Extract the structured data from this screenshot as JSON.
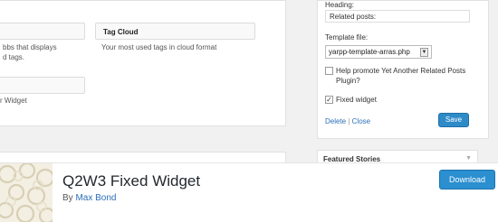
{
  "admin": {
    "widgets": {
      "tag_cloud_title": "Tag Cloud",
      "tag_cloud_desc": "Your most used tags in cloud format",
      "left_desc_line1": "bbs that displays",
      "left_desc_line2": "d tags.",
      "left_widget_desc": "r Widget"
    },
    "yarpp_form": {
      "heading_label": "Heading:",
      "heading_value": "Related posts:",
      "template_label": "Template file:",
      "template_value": "yarpp-template-arras.php",
      "promote_label": "Help promote Yet Another Related Posts Plugin?",
      "promote_checked": false,
      "fixed_widget_label": "Fixed widget",
      "fixed_widget_checked": true,
      "delete_label": "Delete",
      "separator": " | ",
      "close_label": "Close",
      "save_label": "Save"
    },
    "featured_title": "Featured Stories"
  },
  "plugin": {
    "title": "Q2W3 Fixed Widget",
    "by_prefix": "By ",
    "author": "Max Bond",
    "download_label": "Download"
  },
  "colors": {
    "primary_button": "#2b8fd0",
    "link": "#2a6fb8"
  }
}
